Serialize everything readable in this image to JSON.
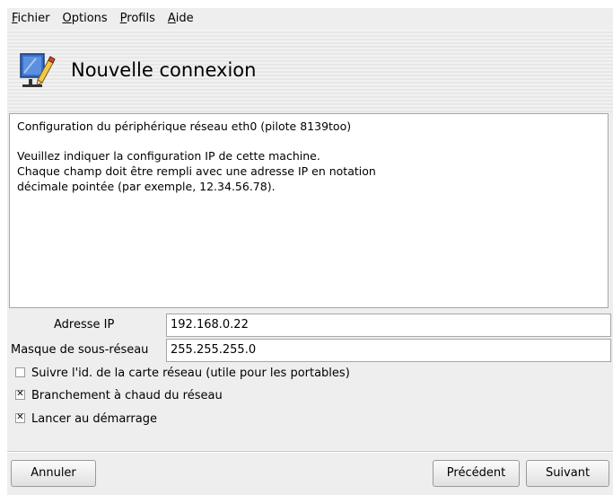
{
  "menubar": {
    "items": [
      {
        "mnemonic": "F",
        "rest": "ichier"
      },
      {
        "mnemonic": "O",
        "rest": "ptions"
      },
      {
        "mnemonic": "P",
        "rest": "rofils"
      },
      {
        "mnemonic": "A",
        "rest": "ide"
      }
    ]
  },
  "header": {
    "icon": "network-edit-icon",
    "title": "Nouvelle connexion"
  },
  "description": {
    "lines": [
      "Configuration du périphérique réseau eth0 (pilote 8139too)",
      "Veuillez indiquer la configuration IP de cette machine.",
      "Chaque champ doit être rempli avec une adresse IP en notation",
      "décimale pointée (par exemple, 12.34.56.78)."
    ]
  },
  "form": {
    "ip_label": "Adresse IP",
    "ip_value": "192.168.0.22",
    "netmask_label": "Masque de sous-réseau",
    "netmask_value": "255.255.255.0"
  },
  "options": [
    {
      "label": "Suivre l'id. de la carte réseau (utile pour les portables)",
      "checked": false
    },
    {
      "label": "Branchement à chaud du réseau",
      "checked": true
    },
    {
      "label": "Lancer au démarrage",
      "checked": true
    }
  ],
  "buttons": {
    "cancel": "Annuler",
    "previous": "Précédent",
    "next": "Suivant"
  }
}
